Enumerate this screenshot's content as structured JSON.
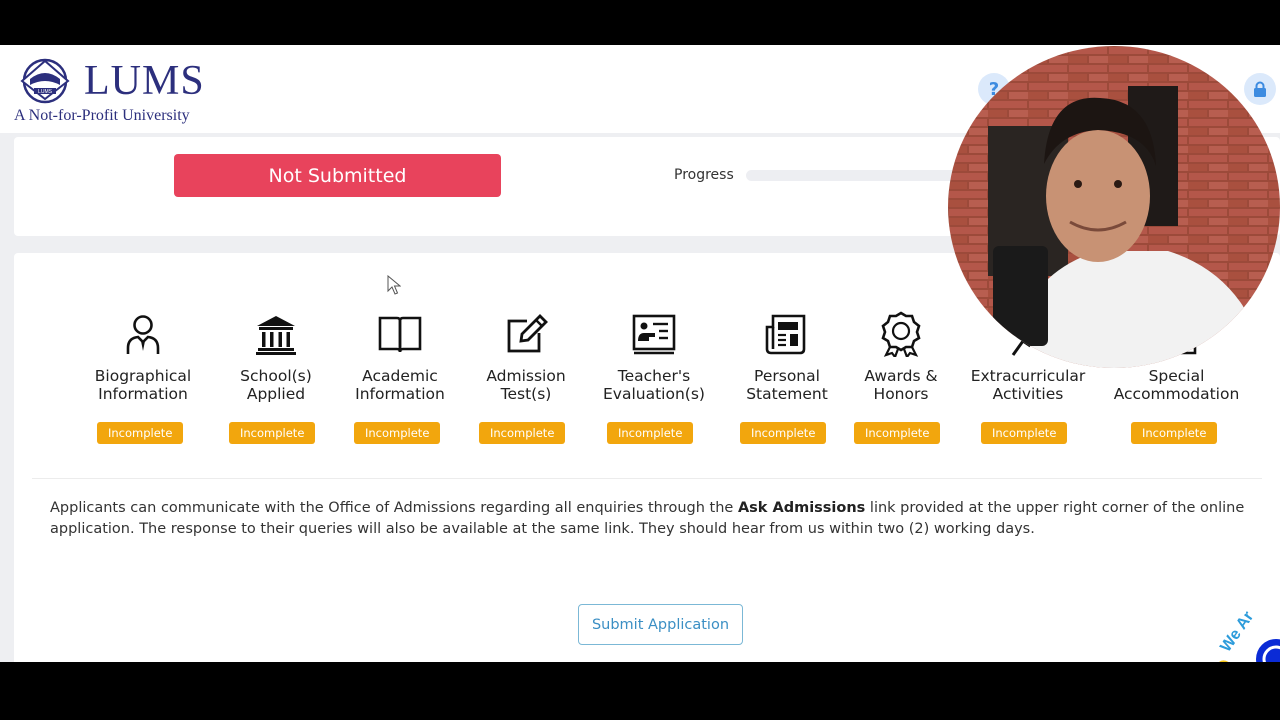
{
  "header": {
    "logo_word": "LUMS",
    "logo_tagline": "A Not-for-Profit University",
    "help_icon": "question-icon",
    "lock_icon": "lock-icon"
  },
  "status": {
    "state_label": "Not Submitted",
    "progress_label": "Progress",
    "progress_fraction": 0.0
  },
  "sections": [
    {
      "label": "Biographical\nInformation",
      "status": "Incomplete",
      "icon": "person-icon"
    },
    {
      "label": "School(s)\nApplied",
      "status": "Incomplete",
      "icon": "institution-icon"
    },
    {
      "label": "Academic\nInformation",
      "status": "Incomplete",
      "icon": "book-icon"
    },
    {
      "label": "Admission\nTest(s)",
      "status": "Incomplete",
      "icon": "edit-icon"
    },
    {
      "label": "Teacher's\nEvaluation(s)",
      "status": "Incomplete",
      "icon": "presentation-icon"
    },
    {
      "label": "Personal\nStatement",
      "status": "Incomplete",
      "icon": "newspaper-icon"
    },
    {
      "label": "Awards &\nHonors",
      "status": "Incomplete",
      "icon": "award-icon"
    },
    {
      "label": "Extracurricular\nActivities",
      "status": "Incomplete",
      "icon": "activity-icon"
    },
    {
      "label": "Special\nAccommodation",
      "status": "Incomplete",
      "icon": "accommodation-icon"
    }
  ],
  "notice": {
    "before": "Applicants can communicate with the Office of Admissions regarding all enquiries through the ",
    "link": "Ask Admissions",
    "after": " link provided at the upper right corner of the online application. The response to their queries will also be available at the same link. They should hear from us within two (2) working days."
  },
  "actions": {
    "submit_label": "Submit Application"
  },
  "chat_widget": {
    "text": "We Ar"
  },
  "colors": {
    "brand": "#2c2f7d",
    "danger": "#e8435c",
    "warning": "#f2a60d",
    "accent": "#3b8fc4"
  }
}
